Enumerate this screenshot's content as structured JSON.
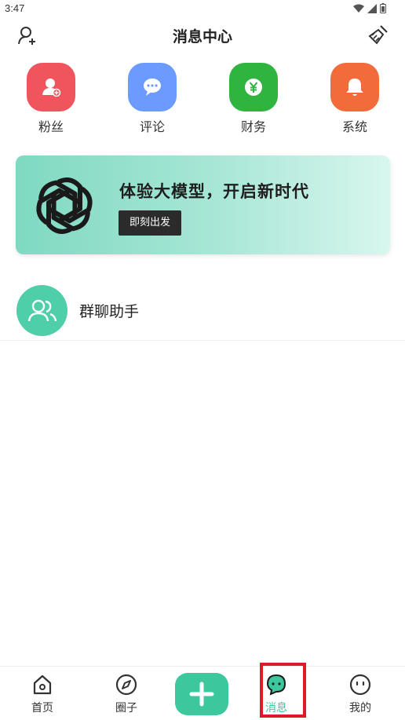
{
  "status_bar": {
    "time": "3:47"
  },
  "header": {
    "title": "消息中心"
  },
  "quick_actions": [
    {
      "label": "粉丝",
      "color": "#f0545c",
      "icon": "user-add-icon"
    },
    {
      "label": "评论",
      "color": "#6b9bff",
      "icon": "comment-bubble-icon"
    },
    {
      "label": "财务",
      "color": "#2fb53f",
      "icon": "yen-coin-icon"
    },
    {
      "label": "系统",
      "color": "#f26b3a",
      "icon": "bell-icon"
    }
  ],
  "banner": {
    "title": "体验大模型，开启新时代",
    "button_label": "即刻出发",
    "icon": "openai-knot-icon"
  },
  "chat_list": [
    {
      "name": "群聊助手",
      "icon": "group-users-icon",
      "color": "#4fcfa9"
    }
  ],
  "tabbar": {
    "items": [
      {
        "label": "首页",
        "icon": "home-icon"
      },
      {
        "label": "圈子",
        "icon": "compass-icon"
      },
      {
        "label": "消息",
        "icon": "chat-bubble-icon",
        "active": true
      },
      {
        "label": "我的",
        "icon": "face-icon"
      }
    ],
    "accent": "#3cc79d"
  }
}
